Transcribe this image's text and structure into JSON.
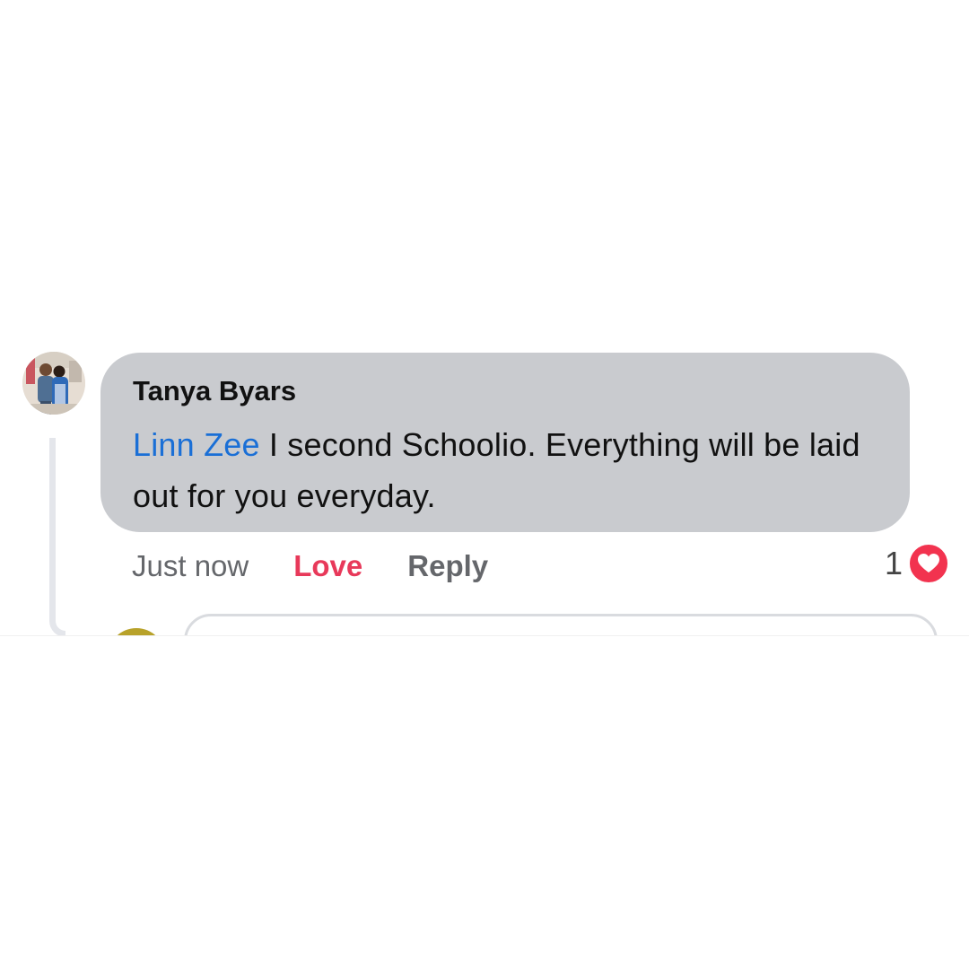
{
  "comment": {
    "author": "Tanya Byars",
    "mention": "Linn Zee",
    "text": " I second Schoolio. Everything will be laid out for you everyday.",
    "timestamp": "Just now",
    "love_label": "Love",
    "reply_label": "Reply",
    "reaction_count": "1",
    "reaction_icon": "heart-icon"
  },
  "colors": {
    "bubble": "#c9cbcf",
    "mention": "#1a6fd6",
    "love": "#e8395a",
    "muted": "#65676b",
    "heart": "#f2334f"
  }
}
